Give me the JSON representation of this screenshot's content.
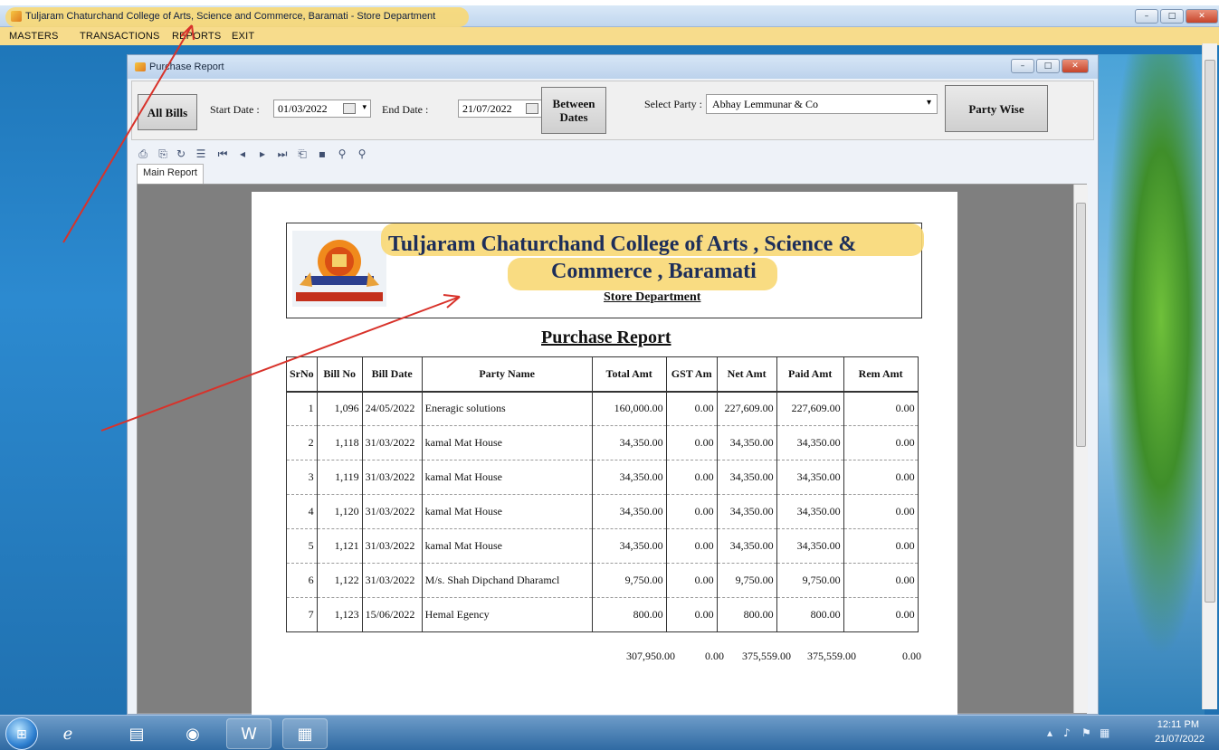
{
  "app": {
    "title": "Tuljaram Chaturchand College of Arts, Science and Commerce, Baramati - Store Department",
    "menu": [
      "MASTERS",
      "TRANSACTIONS",
      "REPORTS",
      "EXIT"
    ]
  },
  "window_controls": {
    "minimize": "–",
    "maximize": "□",
    "close": "✕"
  },
  "child": {
    "title": "Purchase Report",
    "all_bills_label": "All Bills",
    "start_date_label": "Start Date :",
    "start_date_value": "01/03/2022",
    "end_date_label": "End Date :",
    "end_date_value": "21/07/2022",
    "between_dates_label_1": "Between",
    "between_dates_label_2": "Dates",
    "select_party_label": "Select Party :",
    "party_value": "Abhay Lemmunar & Co",
    "party_wise_label": "Party Wise",
    "main_report_tab": "Main Report"
  },
  "report": {
    "college_line1": "Tuljaram Chaturchand College of Arts , Science &",
    "college_line2": "Commerce , Baramati",
    "department": "Store Department",
    "title": "Purchase Report",
    "columns": [
      "SrNo",
      "Bill No",
      "Bill Date",
      "Party Name",
      "Total Amt",
      "GST Am",
      "Net Amt",
      "Paid Amt",
      "Rem Amt"
    ],
    "rows": [
      [
        "1",
        "1,096",
        "24/05/2022",
        "Eneragic solutions",
        "160,000.00",
        "0.00",
        "227,609.00",
        "227,609.00",
        "0.00"
      ],
      [
        "2",
        "1,118",
        "31/03/2022",
        "kamal Mat House",
        "34,350.00",
        "0.00",
        "34,350.00",
        "34,350.00",
        "0.00"
      ],
      [
        "3",
        "1,119",
        "31/03/2022",
        "kamal Mat House",
        "34,350.00",
        "0.00",
        "34,350.00",
        "34,350.00",
        "0.00"
      ],
      [
        "4",
        "1,120",
        "31/03/2022",
        "kamal Mat House",
        "34,350.00",
        "0.00",
        "34,350.00",
        "34,350.00",
        "0.00"
      ],
      [
        "5",
        "1,121",
        "31/03/2022",
        "kamal Mat House",
        "34,350.00",
        "0.00",
        "34,350.00",
        "34,350.00",
        "0.00"
      ],
      [
        "6",
        "1,122",
        "31/03/2022",
        "M/s. Shah Dipchand Dharamcl",
        "9,750.00",
        "0.00",
        "9,750.00",
        "9,750.00",
        "0.00"
      ],
      [
        "7",
        "1,123",
        "15/06/2022",
        "Hemal Egency",
        "800.00",
        "0.00",
        "800.00",
        "800.00",
        "0.00"
      ]
    ],
    "totals": {
      "total_amt": "307,950.00",
      "gst_amt": "0.00",
      "net_amt": "375,559.00",
      "paid_amt": "375,559.00",
      "rem_amt": "0.00"
    }
  },
  "taskbar": {
    "clock_time": "12:11 PM",
    "clock_date": "21/07/2022"
  },
  "icons": [
    "start-orb-icon",
    "ie-icon",
    "explorer-icon",
    "media-icon",
    "word-icon",
    "document-icon",
    "speaker-icon",
    "flag-icon",
    "network-icon"
  ],
  "colors": {
    "highlight": "#f8d874",
    "arrow": "#d8322a"
  }
}
